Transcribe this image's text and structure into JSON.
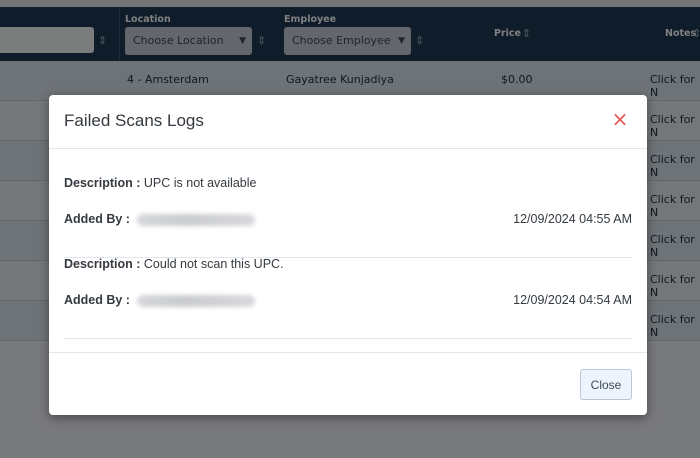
{
  "table": {
    "headers": {
      "location": "Location",
      "employee": "Employee",
      "price": "Price",
      "notes": "Notes"
    },
    "filters": {
      "location_select": "Choose Location",
      "employee_select": "Choose Employee"
    },
    "sort_glyph": "⇕",
    "rows": [
      {
        "location": "4 - Amsterdam",
        "employee": "Gayatree Kunjadiya",
        "price": "$0.00",
        "notes": "Click for N"
      },
      {
        "notes": "Click for N"
      },
      {
        "notes": "Click for N"
      },
      {
        "notes": "Click for N"
      },
      {
        "notes": "Click for N"
      },
      {
        "notes": "Click for N"
      },
      {
        "notes": "Click for N"
      }
    ]
  },
  "modal": {
    "title": "Failed Scans Logs",
    "close_icon": "×",
    "description_label": "Description :",
    "added_by_label": "Added By :",
    "entries": [
      {
        "description": "UPC is not available",
        "timestamp": "12/09/2024 04:55 AM"
      },
      {
        "description": "Could not scan this UPC.",
        "timestamp": "12/09/2024 04:54 AM"
      }
    ],
    "close_button": "Close"
  }
}
